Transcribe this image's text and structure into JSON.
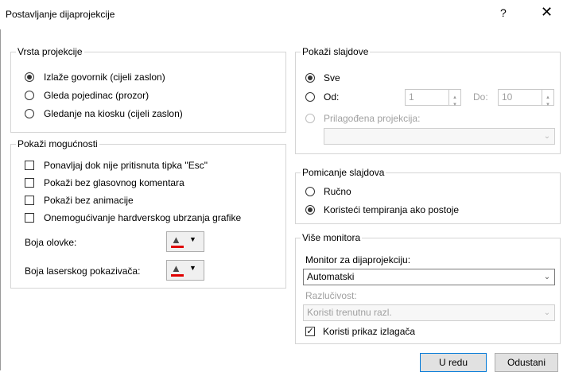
{
  "dialog": {
    "title": "Postavljanje dijaprojekcije",
    "help_label": "?",
    "close_label": "✕"
  },
  "show_type": {
    "legend": "Vrsta projekcije",
    "options": [
      {
        "label": "Izlaže govornik (cijeli zaslon)",
        "selected": true
      },
      {
        "label": "Gleda pojedinac (prozor)",
        "selected": false
      },
      {
        "label": "Gledanje na kiosku (cijeli zaslon)",
        "selected": false
      }
    ]
  },
  "show_options": {
    "legend": "Pokaži mogućnosti",
    "checkboxes": [
      {
        "label": "Ponavljaj dok nije pritisnuta tipka \"Esc\"",
        "checked": false
      },
      {
        "label": "Pokaži bez glasovnog komentara",
        "checked": false
      },
      {
        "label": "Pokaži bez animacije",
        "checked": false
      },
      {
        "label": "Onemogućivanje hardverskog ubrzanja grafike",
        "checked": false
      }
    ],
    "pen_color_label": "Boja olovke:",
    "laser_color_label": "Boja laserskog pokazivača:",
    "pen_color": "#e00000",
    "laser_color": "#e00000"
  },
  "show_slides": {
    "legend": "Pokaži slajdove",
    "all_label": "Sve",
    "from_label": "Od:",
    "from_value": "1",
    "to_label": "Do:",
    "to_value": "10",
    "custom_label": "Prilagođena projekcija:",
    "custom_value": ""
  },
  "advance": {
    "legend": "Pomicanje slajdova",
    "manual_label": "Ručno",
    "timings_label": "Koristeći tempiranja ako postoje"
  },
  "monitors": {
    "legend": "Više monitora",
    "monitor_label": "Monitor za dijaprojekciju:",
    "monitor_value": "Automatski",
    "resolution_label": "Razlučivost:",
    "resolution_value": "Koristi trenutnu razl.",
    "presenter_view_label": "Koristi prikaz izlagača",
    "presenter_view_checked": true
  },
  "buttons": {
    "ok_label": "U redu",
    "cancel_label": "Odustani"
  }
}
